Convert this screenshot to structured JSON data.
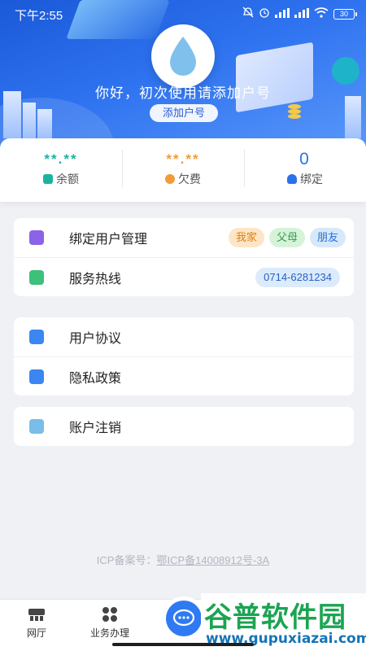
{
  "status_bar": {
    "time": "下午2:55",
    "battery": "30"
  },
  "header": {
    "welcome": "你好，初次使用请添加户号",
    "add_button": "添加户号"
  },
  "stats": [
    {
      "value": "**.**",
      "label": "余额",
      "color": "#1bb3a0",
      "icon": "wallet-icon"
    },
    {
      "value": "**.**",
      "label": "欠费",
      "color": "#f29b38",
      "icon": "yen-icon"
    },
    {
      "value": "0",
      "label": "绑定",
      "color": "#2b72e8",
      "icon": "user-icon"
    }
  ],
  "menu": {
    "bind": {
      "label": "绑定用户管理",
      "tags": [
        "我家",
        "父母",
        "朋友"
      ]
    },
    "hotline": {
      "label": "服务热线",
      "phone": "0714-6281234"
    },
    "agreement": {
      "label": "用户协议"
    },
    "privacy": {
      "label": "隐私政策"
    },
    "cancel": {
      "label": "账户注销"
    }
  },
  "icp": {
    "prefix": "ICP备案号：",
    "number": "鄂ICP备14008912号-3A"
  },
  "tabbar": {
    "items": [
      "网厅",
      "业务办理"
    ]
  },
  "watermark": {
    "title": "谷普软件园",
    "url": "www.gupuxiazai.com"
  },
  "colors": {
    "primary": "#2f73f0",
    "teal": "#1bb3a0",
    "orange": "#f29b38"
  }
}
